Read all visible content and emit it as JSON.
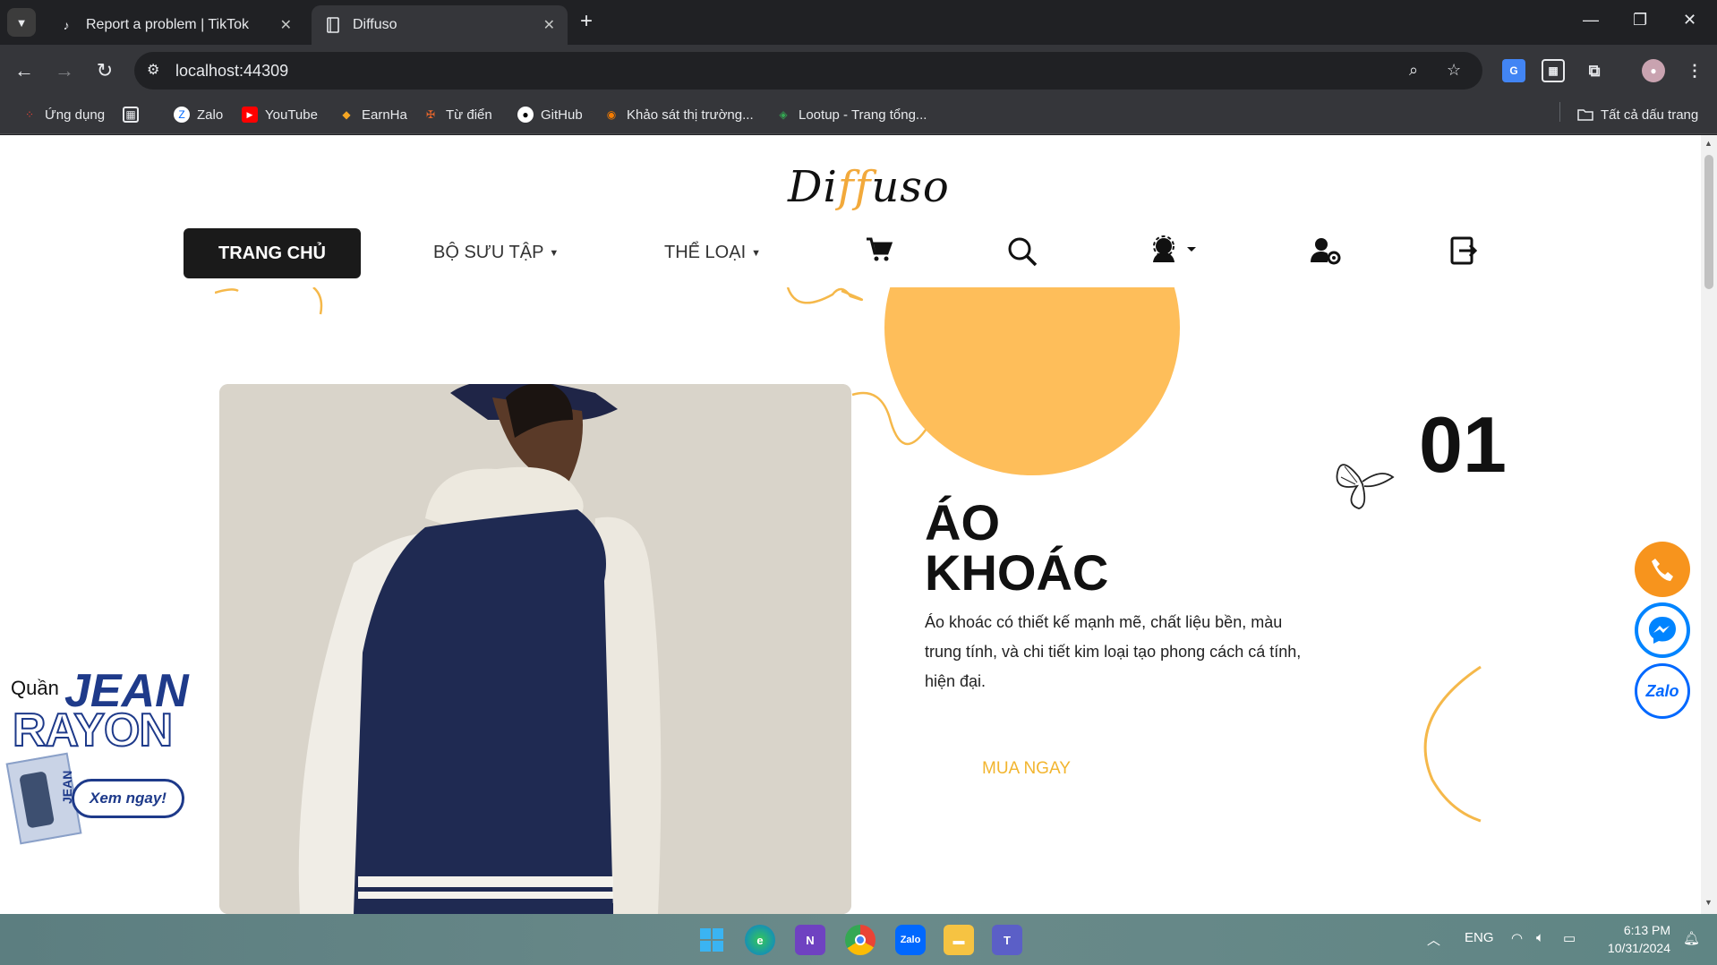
{
  "browser": {
    "tabs": [
      {
        "title": "Report a problem | TikTok",
        "active": false
      },
      {
        "title": "Diffuso",
        "active": true
      }
    ],
    "url": "localhost:44309",
    "bookmarks": [
      {
        "label": "Ứng dụng",
        "icon": "apps-grid-icon"
      },
      {
        "label": "Zalo",
        "icon": "zalo-icon"
      },
      {
        "label": "YouTube",
        "icon": "youtube-icon"
      },
      {
        "label": "EarnHa",
        "icon": "earnha-icon"
      },
      {
        "label": "Từ điển",
        "icon": "dictionary-icon"
      },
      {
        "label": "GitHub",
        "icon": "github-icon"
      },
      {
        "label": "Khảo sát thị trường...",
        "icon": "survey-icon"
      },
      {
        "label": "Lootup - Trang tổng...",
        "icon": "lootup-icon"
      }
    ],
    "all_bookmarks": "Tất cả dấu trang"
  },
  "site": {
    "logo_prefix": "Di",
    "logo_ff": "ff",
    "logo_suffix": "uso",
    "nav": {
      "home": "TRANG CHỦ",
      "collection": "BỘ SƯU TẬP",
      "category": "THỂ LOẠI"
    },
    "hero": {
      "number": "01",
      "title_line1": "ÁO",
      "title_line2": "KHOÁC",
      "description": "Áo khoác có thiết kế mạnh mẽ, chất liệu bền, màu trung tính, và chi tiết kim loại tạo phong cách cá tính, hiện đại.",
      "cta": "MUA NGAY"
    },
    "promo": {
      "line1": "Quần",
      "line2": "JEAN",
      "line3": "RAYON",
      "cta": "Xem ngay!",
      "tag": "JEAN"
    },
    "float_zalo": "Zalo"
  },
  "taskbar": {
    "lang": "ENG",
    "time": "6:13 PM",
    "date": "10/31/2024"
  },
  "colors": {
    "accent": "#febe5a",
    "cta": "#f2b52f",
    "phone": "#f7941d",
    "messenger": "#0084ff",
    "zalo": "#0068ff"
  }
}
